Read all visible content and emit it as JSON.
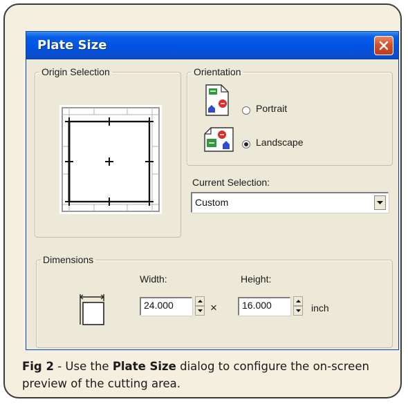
{
  "dialog": {
    "title": "Plate Size",
    "close_icon": "close-icon"
  },
  "origin": {
    "legend": "Origin Selection"
  },
  "orientation": {
    "legend": "Orientation",
    "options": [
      {
        "label": "Portrait",
        "selected": false,
        "icon": "portrait-page-icon"
      },
      {
        "label": "Landscape",
        "selected": true,
        "icon": "landscape-page-icon"
      }
    ]
  },
  "current_selection": {
    "label": "Current Selection:",
    "value": "Custom"
  },
  "dimensions": {
    "legend": "Dimensions",
    "width_label": "Width:",
    "width_value": "24.000",
    "times": "×",
    "height_label": "Height:",
    "height_value": "16.000",
    "unit": "inch",
    "icon": "plate-dimension-icon"
  },
  "caption": {
    "fig": "Fig 2",
    "sep": " - Use the ",
    "bold": "Plate Size",
    "rest": " dialog to configure the on-screen preview of the cutting area."
  },
  "colors": {
    "titlebar": "#0054e3",
    "dialog_bg": "#ece9d8",
    "close": "#d2502b",
    "card_bg": "#f4efdf"
  }
}
